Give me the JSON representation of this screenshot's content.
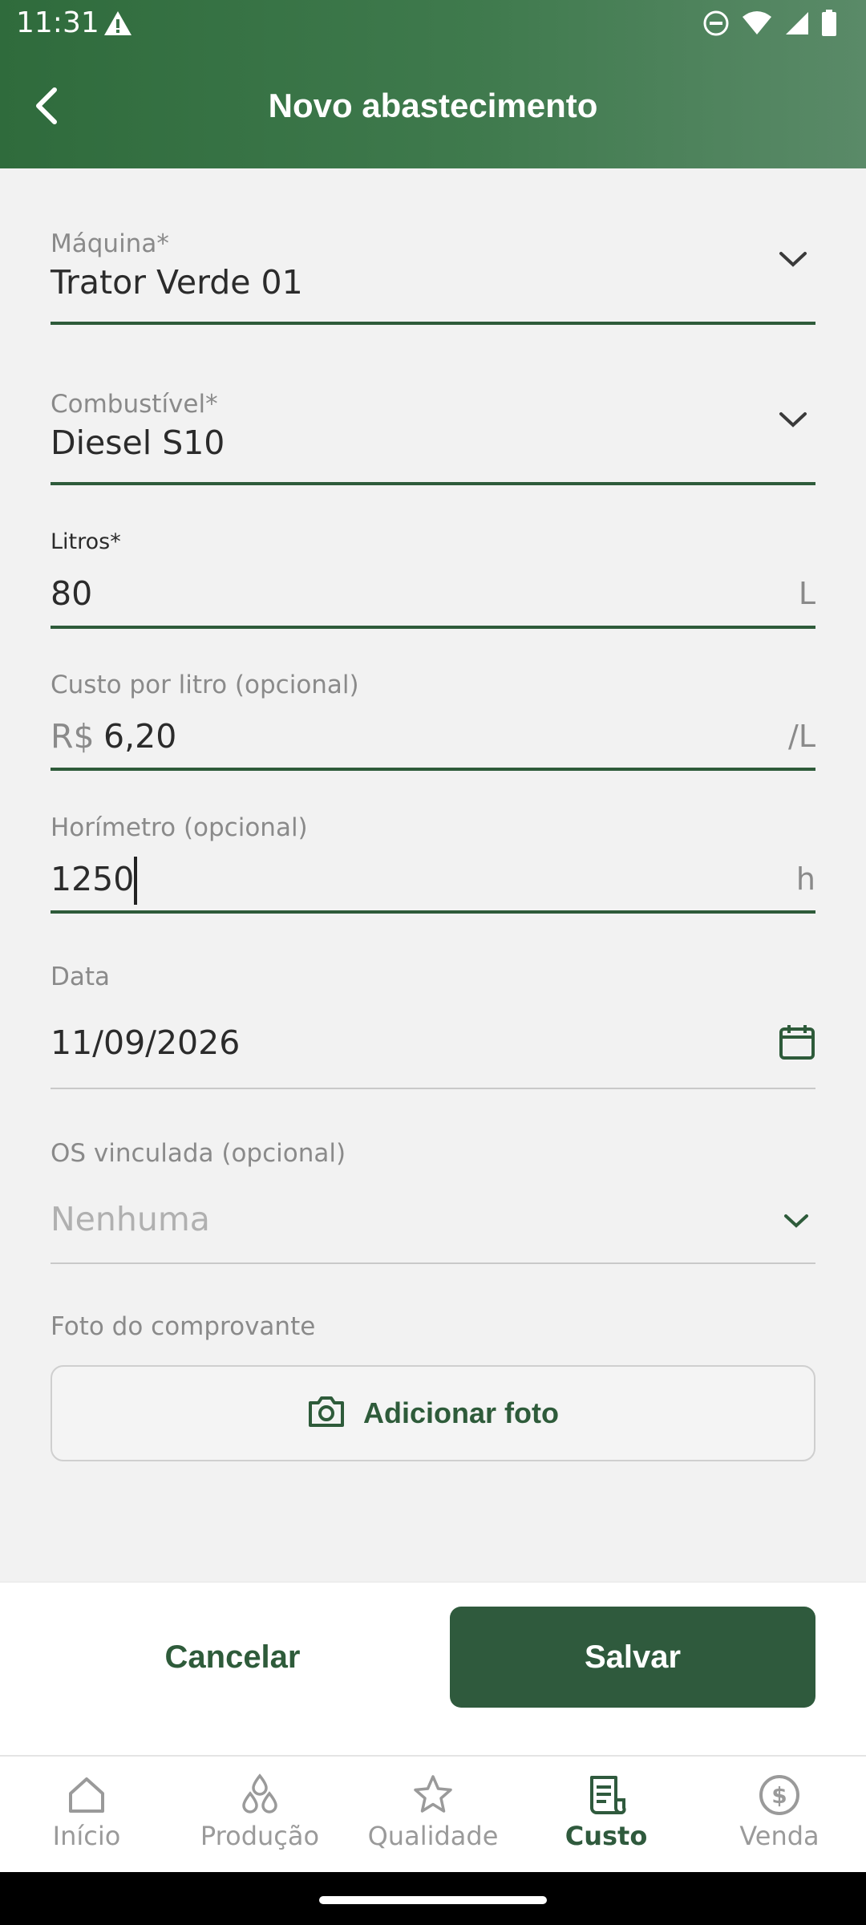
{
  "status_bar": {
    "time": "11:31"
  },
  "header": {
    "title": "Novo abastecimento"
  },
  "form": {
    "maquina": {
      "label": "Máquina*",
      "value": "Trator Verde 01"
    },
    "combustivel": {
      "label": "Combustível*",
      "value": "Diesel S10"
    },
    "litros": {
      "label": "Litros*",
      "value": "80",
      "suffix": "L"
    },
    "custo": {
      "label": "Custo por litro (opcional)",
      "prefix": "R$",
      "value": "6,20",
      "suffix": "/L"
    },
    "horimetro": {
      "label": "Horímetro (opcional)",
      "value": "1250",
      "suffix": "h"
    },
    "data": {
      "label": "Data",
      "value": "11/09/2026"
    },
    "os": {
      "label": "OS vinculada (opcional)",
      "placeholder": "Nenhuma"
    },
    "foto": {
      "label": "Foto do comprovante",
      "button": "Adicionar foto"
    }
  },
  "actions": {
    "cancel": "Cancelar",
    "save": "Salvar"
  },
  "bottom_nav": {
    "items": [
      {
        "label": "Início",
        "icon": "home-icon"
      },
      {
        "label": "Produção",
        "icon": "drops-icon"
      },
      {
        "label": "Qualidade",
        "icon": "star-icon"
      },
      {
        "label": "Custo",
        "icon": "receipt-icon",
        "active": true
      },
      {
        "label": "Venda",
        "icon": "dollar-circle-icon"
      }
    ]
  },
  "colors": {
    "primary": "#2f5a3d",
    "header": "#3f7a4d",
    "muted": "#8a8a8a"
  }
}
